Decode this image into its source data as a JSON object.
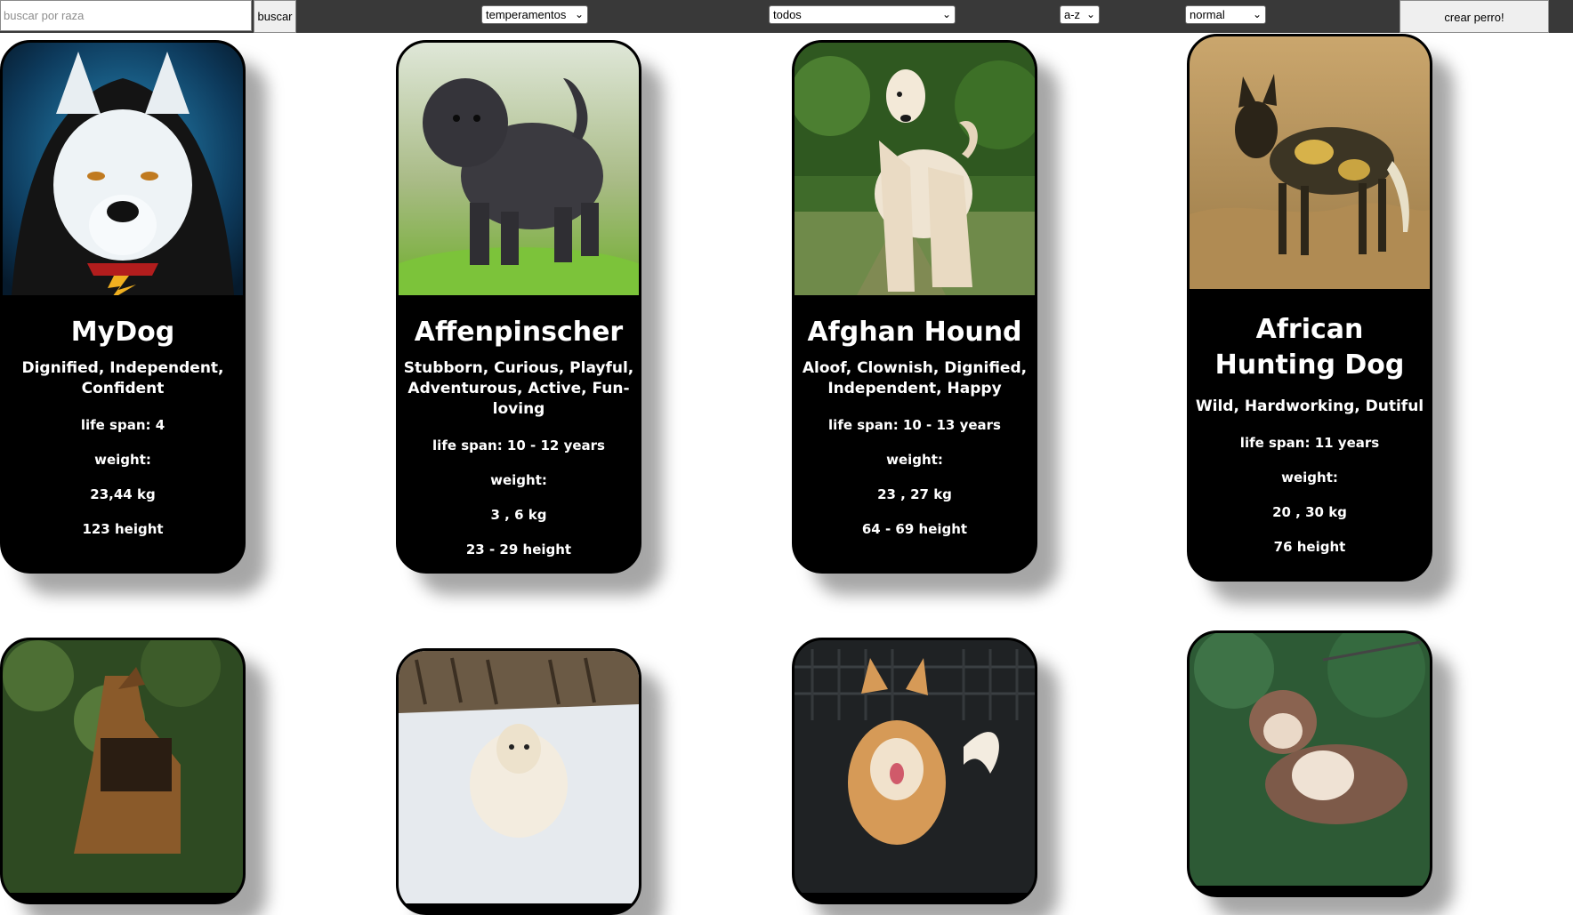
{
  "toolbar": {
    "search_placeholder": "buscar por raza",
    "search_button": "buscar",
    "temperament_select": "temperamentos",
    "origin_select": "todos",
    "order_select": "a-z",
    "weight_select": "normal",
    "create_button": "crear perro!"
  },
  "dogs": [
    {
      "name": "MyDog",
      "temperament": "Dignified, Independent, Confident",
      "life_span": "life span: 4",
      "weight_label": "weight:",
      "weight": "23,44 kg",
      "height": "123 height"
    },
    {
      "name": "Affenpinscher",
      "temperament": "Stubborn, Curious, Playful, Adventurous, Active, Fun-loving",
      "life_span": "life span: 10 - 12 years",
      "weight_label": "weight:",
      "weight": "3 , 6 kg",
      "height": "23 - 29 height"
    },
    {
      "name": "Afghan Hound",
      "temperament": "Aloof, Clownish, Dignified, Independent, Happy",
      "life_span": "life span: 10 - 13 years",
      "weight_label": "weight:",
      "weight": "23 , 27 kg",
      "height": "64 - 69 height"
    },
    {
      "name": "African Hunting Dog",
      "temperament": "Wild, Hardworking, Dutiful",
      "life_span": "life span: 11 years",
      "weight_label": "weight:",
      "weight": "20 , 30 kg",
      "height": "76 height"
    }
  ],
  "icons": {
    "chevron": "chevron-down-icon"
  }
}
